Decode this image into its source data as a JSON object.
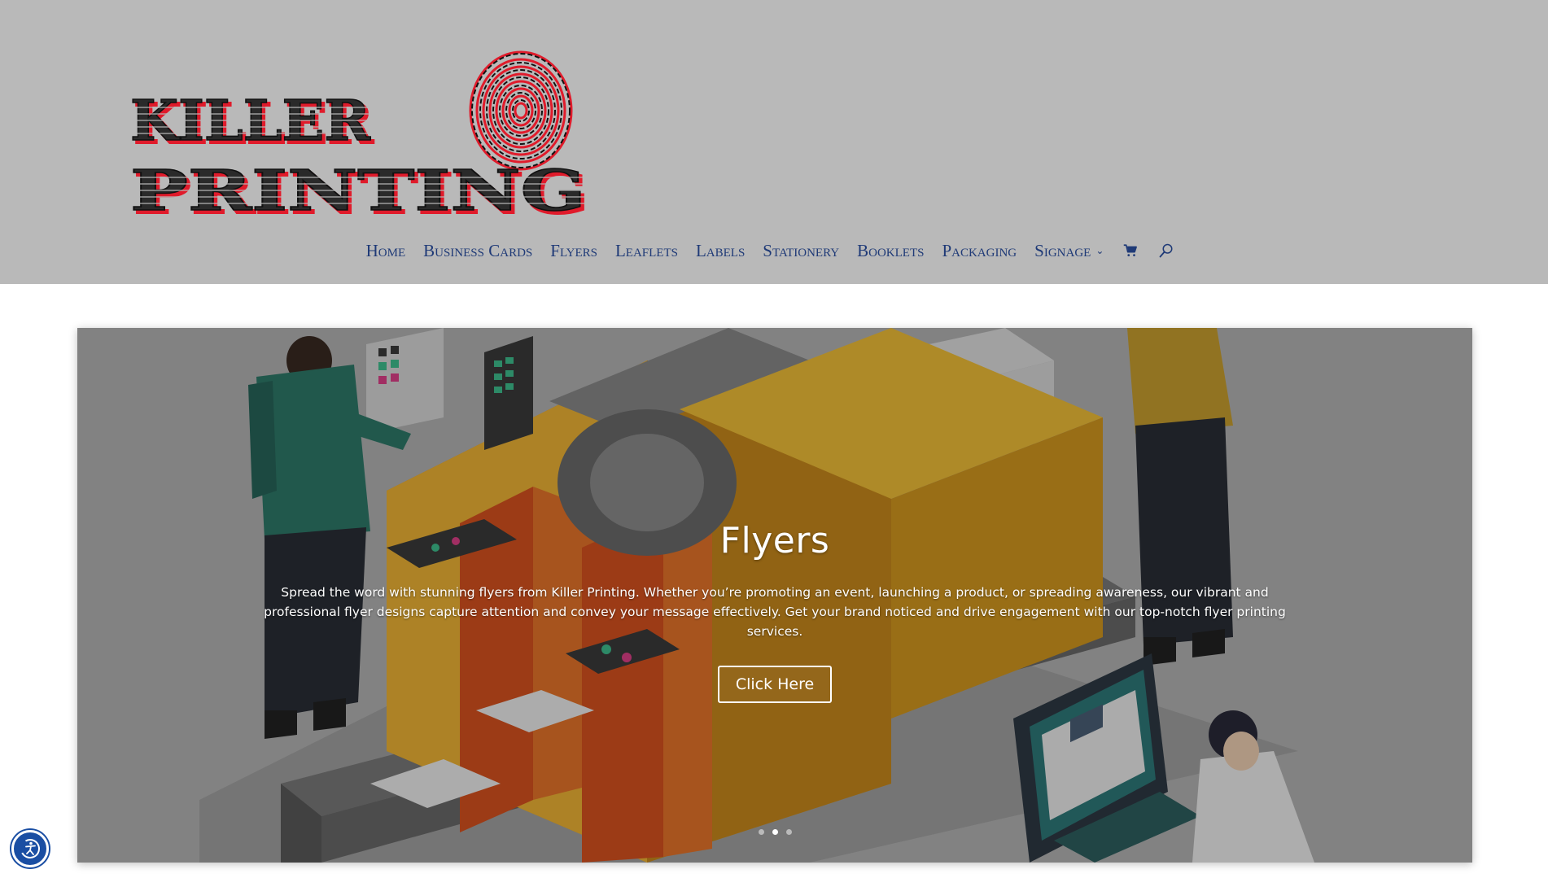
{
  "brand": {
    "line1": "KILLER",
    "line2": "PRINTING"
  },
  "nav": {
    "items": [
      {
        "label": "Home"
      },
      {
        "label": "Business Cards"
      },
      {
        "label": "Flyers"
      },
      {
        "label": "Leaflets"
      },
      {
        "label": "Labels"
      },
      {
        "label": "Stationery"
      },
      {
        "label": "Booklets"
      },
      {
        "label": "Packaging"
      },
      {
        "label": "Signage",
        "has_dropdown": true
      }
    ],
    "cart_icon": "shopping-cart-icon",
    "search_icon": "search-icon",
    "dropdown_icon": "chevron-down-icon"
  },
  "hero": {
    "title": "Flyers",
    "description": "Spread the word with stunning flyers from Killer Printing. Whether you’re promoting an event, launching a product, or spreading awareness, our vibrant and professional flyer designs capture attention and convey your message effectively. Get your brand noticed and drive engagement with our top-notch flyer printing services.",
    "button_label": "Click Here",
    "slides_count": 3,
    "active_slide": 2
  },
  "accessibility": {
    "icon": "accessibility-icon"
  },
  "colors": {
    "header_bg": "#b9b9b9",
    "nav_text": "#1f3a77",
    "logo_red": "#e01b2b",
    "a11y_blue": "#1a4ea3"
  }
}
